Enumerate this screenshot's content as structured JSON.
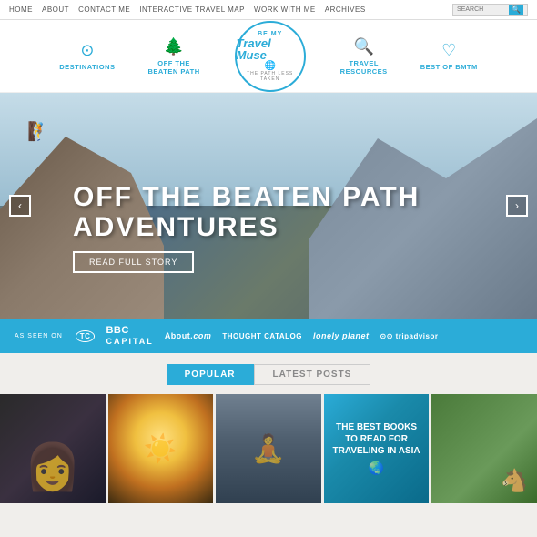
{
  "topnav": {
    "links": [
      "HOME",
      "ABOUT",
      "CONTACT ME",
      "INTERACTIVE TRAVEL MAP",
      "WORK WITH ME",
      "ARCHIVES"
    ],
    "search_placeholder": "SEARCH"
  },
  "mainnav": {
    "logo": {
      "be_my": "BE MY",
      "travel_muse": "Travel Muse",
      "tagline": "THE PATH LESS TAKEN"
    },
    "items": [
      {
        "id": "destinations",
        "label": "DESTINATIONS",
        "icon": "⊙"
      },
      {
        "id": "off-beaten-path",
        "label": "OFF THE\nBEATEN PATH",
        "icon": "♣"
      },
      {
        "id": "travel-resources",
        "label": "TRAVEL\nRESOURCES",
        "icon": "⊕"
      },
      {
        "id": "best-of-bmtm",
        "label": "BEST OF BMTM",
        "icon": "♡"
      }
    ]
  },
  "hero": {
    "title": "OFF THE BEATEN\nPATH ADVENTURES",
    "read_full_story": "READ FULL STORY",
    "arrow_left": "‹",
    "arrow_right": "›"
  },
  "as_seen_on": {
    "label": "AS SEEN ON",
    "brands": [
      {
        "id": "tc",
        "name": "TC"
      },
      {
        "id": "bbc-capital",
        "name": "BBC CAPITAL"
      },
      {
        "id": "about",
        "name": "About.com"
      },
      {
        "id": "thought-catalog",
        "name": "THOUGHT CATALOG"
      },
      {
        "id": "lonely-planet",
        "name": "lonely planet"
      },
      {
        "id": "tripadvisor",
        "name": "⊙⊙ tripadvisor"
      }
    ]
  },
  "tabs": {
    "popular": "POPULAR",
    "latest": "LATEST POSTS"
  },
  "grid": {
    "items": [
      {
        "id": "photo-1",
        "alt": "Woman in colorful clothes"
      },
      {
        "id": "photo-2",
        "alt": "Sunrise over water"
      },
      {
        "id": "photo-3",
        "alt": "Person doing yoga on beach"
      },
      {
        "id": "photo-4",
        "alt": "Best books for traveling in Asia",
        "title": "THE BEST BOOKS\nTO READ FOR\nTRAVELING\nIN ASIA"
      },
      {
        "id": "photo-5",
        "alt": "Coastal landscape with horse"
      }
    ]
  }
}
